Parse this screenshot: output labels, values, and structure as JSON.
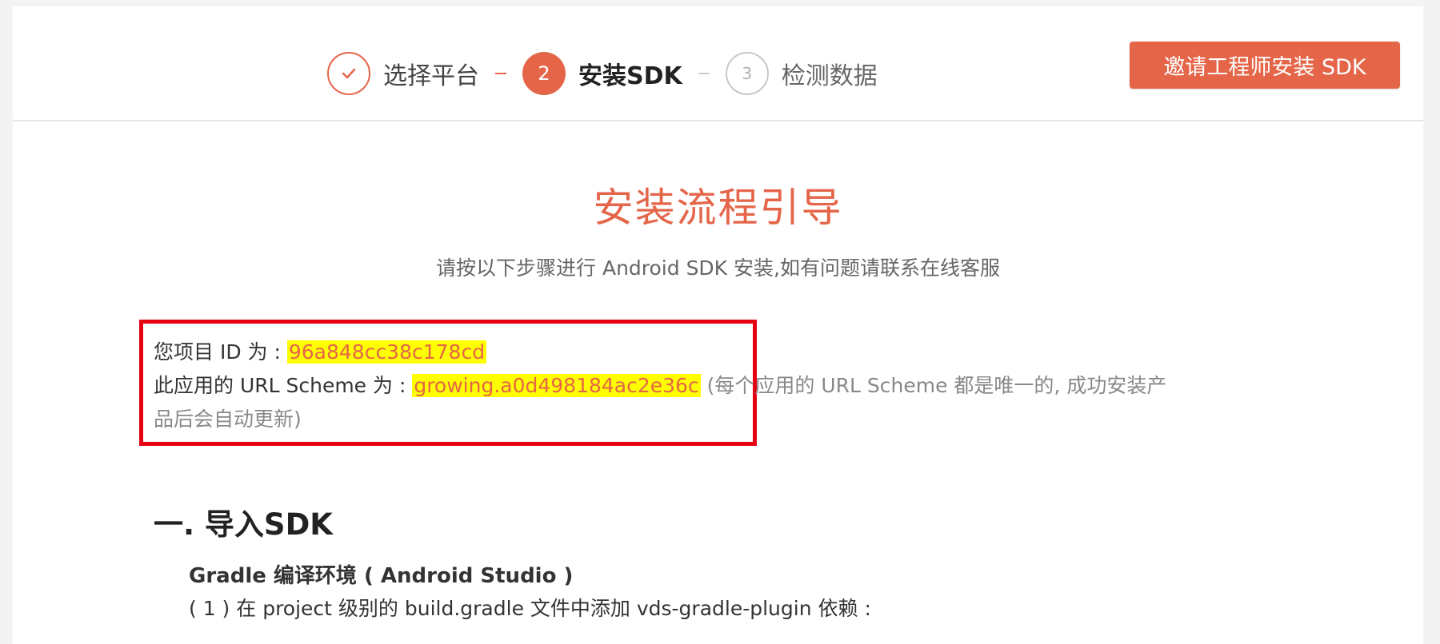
{
  "header": {
    "steps": [
      {
        "number": "",
        "label": "选择平台",
        "state": "done",
        "icon": "check-icon"
      },
      {
        "number": "2",
        "label": "安装SDK",
        "state": "active"
      },
      {
        "number": "3",
        "label": "检测数据",
        "state": "pending"
      }
    ],
    "invite_button_label": "邀请工程师安装 SDK"
  },
  "guide": {
    "title": "安装流程引导",
    "subtitle": "请按以下步骤进行 Android SDK 安装,如有问题请联系在线客服"
  },
  "project_info": {
    "id_label": "您项目 ID 为 : ",
    "id_value": "96a848cc38c178cd",
    "scheme_label": "此应用的 URL Scheme 为 : ",
    "scheme_value": "growing.a0d498184ac2e36c",
    "scheme_note_line1": " (每个应用的 URL Scheme 都是唯一的, 成功安装产",
    "scheme_note_line2": "品后会自动更新)"
  },
  "section": {
    "title": "一. 导入SDK",
    "env_title": "Gradle 编译环境 ( Android Studio )",
    "step1": "( 1 ) 在 project 级别的 build.gradle 文件中添加 vds-gradle-plugin 依赖 :"
  },
  "colors": {
    "accent": "#e56549",
    "highlight": "#ffff00",
    "annotation_border": "#e60012"
  }
}
